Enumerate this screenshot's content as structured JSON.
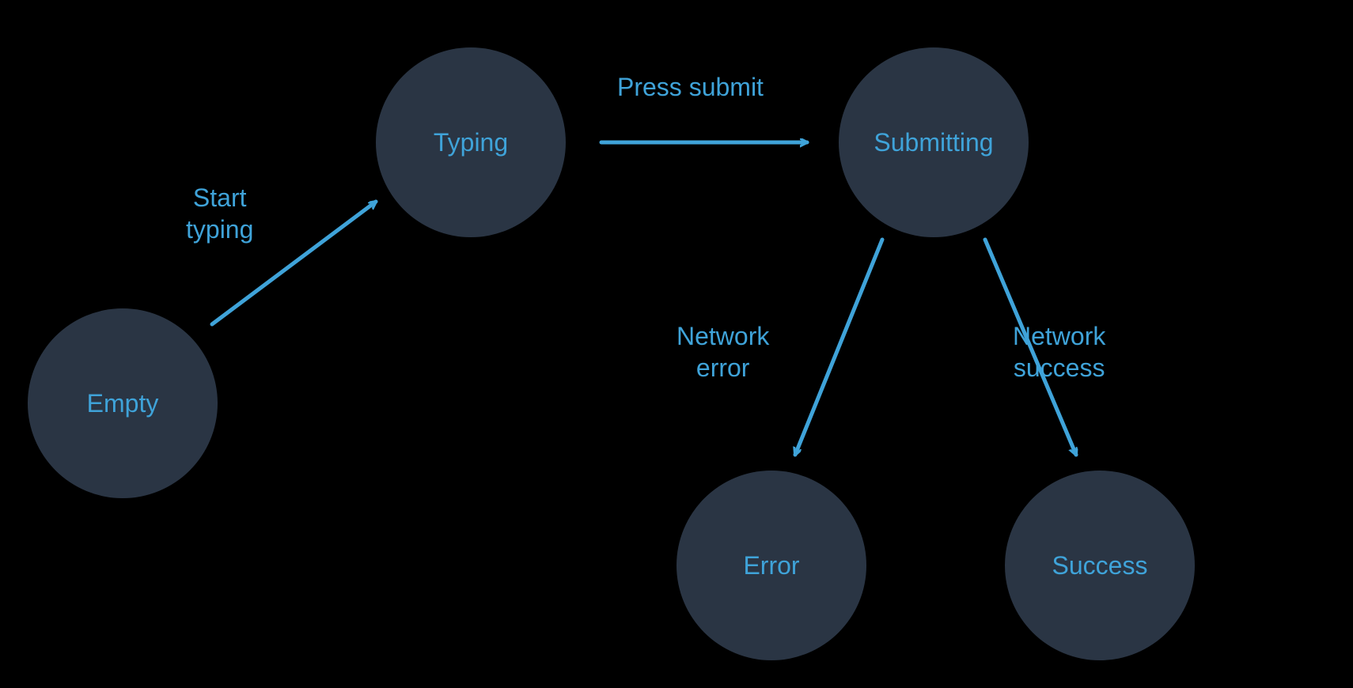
{
  "states": {
    "empty": "Empty",
    "typing": "Typing",
    "submitting": "Submitting",
    "error": "Error",
    "success": "Success"
  },
  "transitions": {
    "startTyping": "Start\ntyping",
    "pressSubmit": "Press submit",
    "networkError": "Network\nerror",
    "networkSuccess": "Network\nsuccess"
  },
  "colors": {
    "background": "#000000",
    "nodeFill": "#2a3544",
    "text": "#3fa3d9",
    "arrow": "#3fa3d9"
  }
}
